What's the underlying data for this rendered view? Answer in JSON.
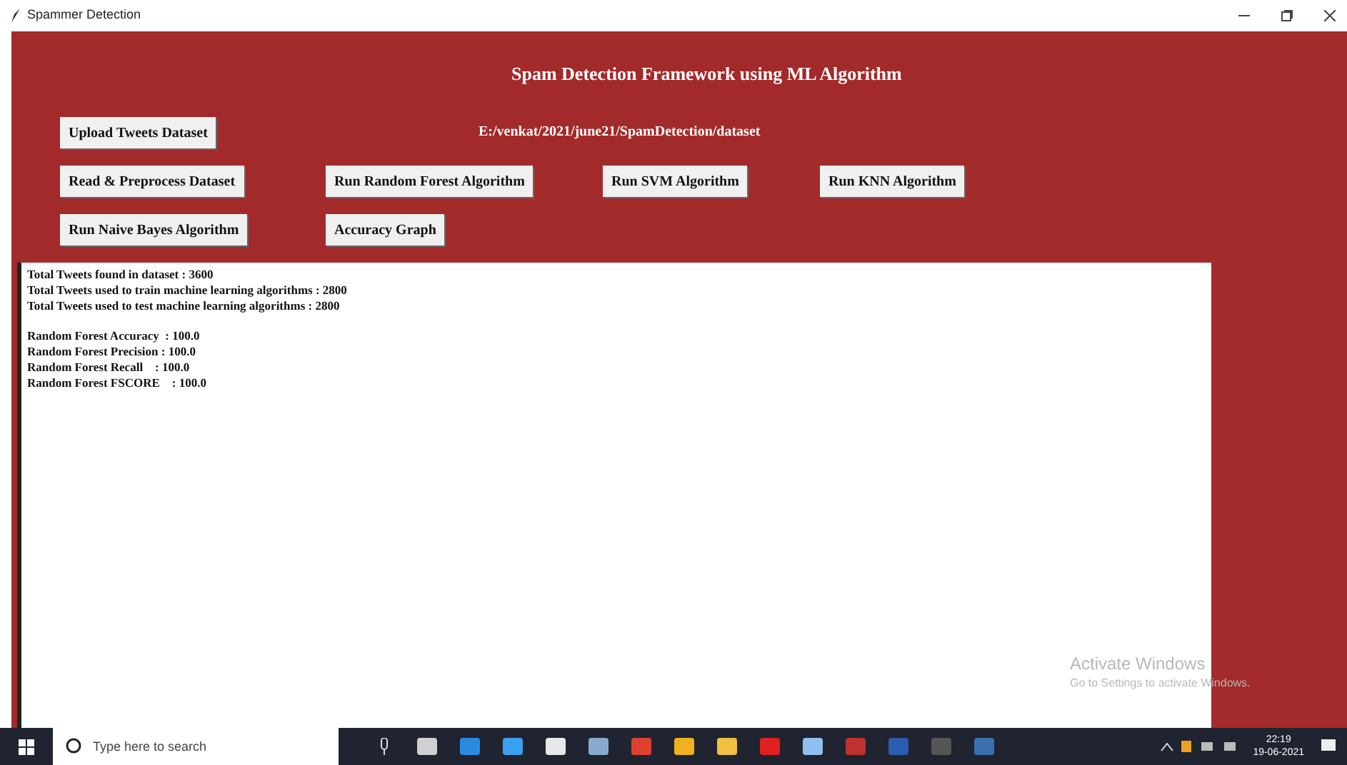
{
  "window": {
    "title": "Spammer Detection"
  },
  "heading": "Spam Detection Framework using ML Algorithm",
  "dataset_path": "E:/venkat/2021/june21/SpamDetection/dataset",
  "button_rows": [
    [
      "Upload Tweets Dataset"
    ],
    [
      "Read & Preprocess Dataset",
      "Run Random Forest Algorithm",
      "Run SVM Algorithm",
      "Run KNN Algorithm"
    ],
    [
      "Run Naive Bayes Algorithm",
      "Accuracy Graph"
    ]
  ],
  "output_blocks": [
    [
      "Total Tweets found in dataset : 3600",
      "Total Tweets used to train machine learning algorithms : 2800",
      "Total Tweets used to test machine learning algorithms : 2800"
    ],
    [
      "Random Forest Accuracy  : 100.0",
      "Random Forest Precision : 100.0",
      "Random Forest Recall    : 100.0",
      "Random Forest FSCORE    : 100.0"
    ]
  ],
  "activation": {
    "title": "Activate Windows",
    "subtitle": "Go to Settings to activate Windows."
  },
  "taskbar": {
    "search": {
      "placeholder": "Type here to search"
    },
    "time": "22:19",
    "date": "19-06-2021"
  }
}
